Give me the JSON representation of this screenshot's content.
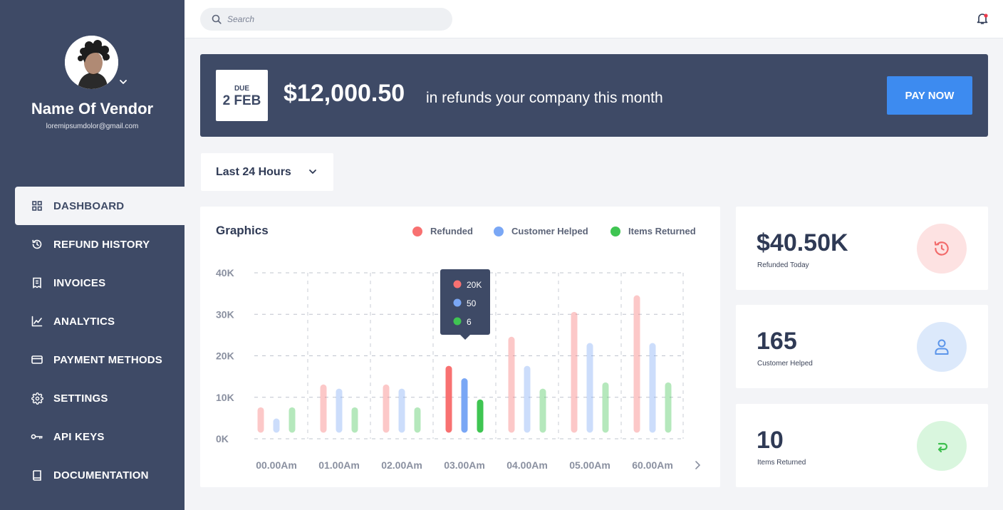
{
  "sidebar": {
    "vendor_name": "Name Of Vendor",
    "vendor_email": "loremipsumdolor@gmail.com",
    "items": [
      {
        "label": "DASHBOARD",
        "icon": "grid-icon",
        "active": true
      },
      {
        "label": "REFUND HISTORY",
        "icon": "history-icon",
        "active": false
      },
      {
        "label": "INVOICES",
        "icon": "invoice-icon",
        "active": false
      },
      {
        "label": "ANALYTICS",
        "icon": "analytics-icon",
        "active": false
      },
      {
        "label": "PAYMENT METHODS",
        "icon": "card-icon",
        "active": false
      },
      {
        "label": "SETTINGS",
        "icon": "gear-icon",
        "active": false
      },
      {
        "label": "API KEYS",
        "icon": "key-icon",
        "active": false
      },
      {
        "label": "DOCUMENTATION",
        "icon": "book-icon",
        "active": false
      }
    ]
  },
  "topbar": {
    "search_placeholder": "Search"
  },
  "banner": {
    "due_label": "DUE",
    "due_date": "2 FEB",
    "amount": "$12,000.50",
    "text": "in refunds your company this month",
    "pay_button": "PAY NOW"
  },
  "filter": {
    "selected": "Last 24 Hours"
  },
  "graphics": {
    "title": "Graphics"
  },
  "colors": {
    "refunded": "#f87171",
    "customer_helped": "#7aa7f5",
    "items_returned": "#3fc552",
    "sidebar": "#3e4a66",
    "accent": "#3d8bf0"
  },
  "chart_data": {
    "type": "bar",
    "categories": [
      "00.00Am",
      "01.00Am",
      "02.00Am",
      "03.00Am",
      "04.00Am",
      "05.00Am",
      "60.00Am"
    ],
    "series": [
      {
        "name": "Refunded",
        "values": [
          7500,
          13000,
          13000,
          17500,
          24500,
          30500,
          34500
        ]
      },
      {
        "name": "Customer Helped",
        "values": [
          4800,
          12000,
          12000,
          14500,
          17500,
          23000,
          23000
        ]
      },
      {
        "name": "Items Returned",
        "values": [
          7500,
          7500,
          7500,
          9400,
          12000,
          13500,
          13500
        ]
      }
    ],
    "yticks": [
      "40K",
      "30K",
      "20K",
      "10K",
      "0K"
    ],
    "ylim": [
      0,
      40000
    ],
    "highlighted_index": 3,
    "tooltip": [
      "20K",
      "50",
      "6"
    ],
    "legend_position": "top-right",
    "grid": true
  },
  "stats": [
    {
      "value": "$40.50K",
      "label": "Refunded Today",
      "icon": "refund-history-icon",
      "bg": "#fde2e2",
      "fg": "#f26b6b"
    },
    {
      "value": "165",
      "label": "Customer Helped",
      "icon": "user-icon",
      "bg": "#dce9fb",
      "fg": "#5b95ea"
    },
    {
      "value": "10",
      "label": "Items Returned",
      "icon": "return-arrow-icon",
      "bg": "#d9f6de",
      "fg": "#3dbf4e"
    }
  ]
}
